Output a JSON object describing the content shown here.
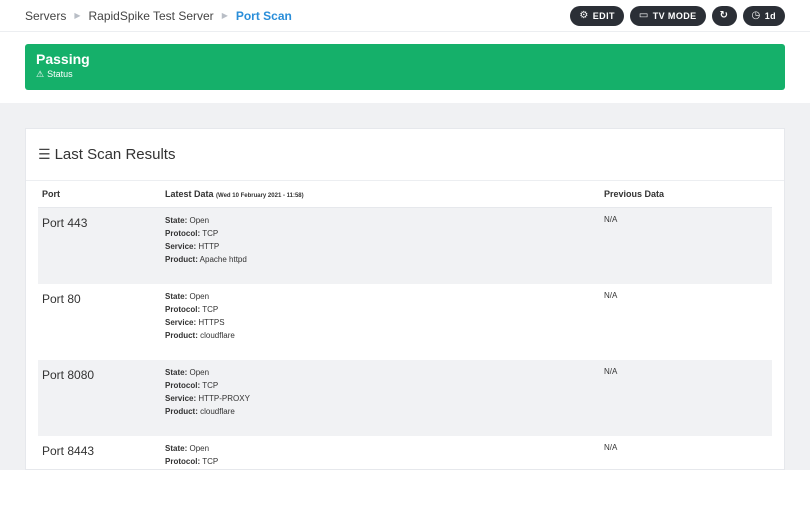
{
  "breadcrumb": {
    "items": [
      "Servers",
      "RapidSpike Test Server"
    ],
    "current": "Port Scan"
  },
  "toolbar": {
    "edit_label": "EDIT",
    "tv_mode_label": "TV MODE",
    "range_label": "1d"
  },
  "status": {
    "title": "Passing",
    "subtitle": "Status",
    "color": "#15b06a"
  },
  "card": {
    "title": "Last Scan Results"
  },
  "table": {
    "headers": {
      "port": "Port",
      "latest": "Latest Data",
      "latest_date": "(Wed 10 February 2021 - 11:58)",
      "previous": "Previous Data"
    },
    "field_labels": {
      "state": "State:",
      "protocol": "Protocol:",
      "service": "Service:",
      "product": "Product:"
    },
    "rows": [
      {
        "port": "Port 443",
        "state": "Open",
        "protocol": "TCP",
        "service": "HTTP",
        "product": "Apache httpd",
        "previous": "N/A"
      },
      {
        "port": "Port 80",
        "state": "Open",
        "protocol": "TCP",
        "service": "HTTPS",
        "product": "cloudflare",
        "previous": "N/A"
      },
      {
        "port": "Port 8080",
        "state": "Open",
        "protocol": "TCP",
        "service": "HTTP-PROXY",
        "product": "cloudflare",
        "previous": "N/A"
      },
      {
        "port": "Port 8443",
        "state": "Open",
        "protocol": "TCP",
        "service": "",
        "product": "",
        "previous": "N/A"
      }
    ]
  }
}
